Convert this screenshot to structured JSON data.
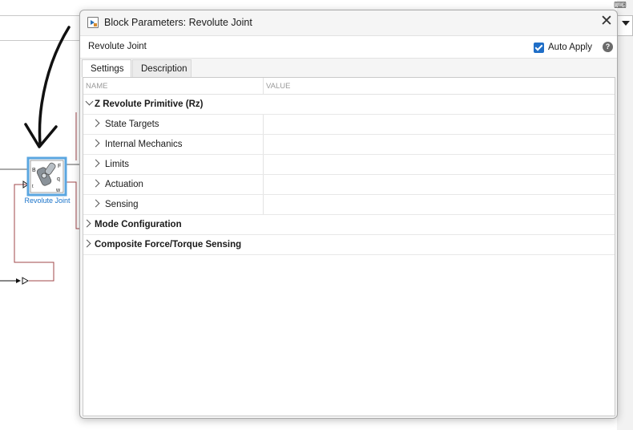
{
  "canvas": {
    "block": {
      "label": "Revolute Joint",
      "port_left_top": "B",
      "port_right_top": "F",
      "port_right_mid": "q",
      "port_left_bottom": "t",
      "port_right_bottom": "w"
    }
  },
  "dialog": {
    "title": "Block Parameters: Revolute Joint",
    "close_glyph": "✕",
    "block_name": "Revolute Joint",
    "auto_apply": {
      "label": "Auto Apply",
      "checked": true
    },
    "help_glyph": "?",
    "tabs": [
      {
        "label": "Settings",
        "active": true
      },
      {
        "label": "Description",
        "active": false
      }
    ],
    "columns": {
      "name": "NAME",
      "value": "VALUE"
    },
    "groups": [
      {
        "label": "Z Revolute Primitive (Rz)",
        "expanded": true,
        "children": [
          {
            "label": "State Targets"
          },
          {
            "label": "Internal Mechanics"
          },
          {
            "label": "Limits"
          },
          {
            "label": "Actuation"
          },
          {
            "label": "Sensing"
          }
        ]
      },
      {
        "label": "Mode Configuration",
        "expanded": false
      },
      {
        "label": "Composite Force/Torque Sensing",
        "expanded": false
      }
    ]
  },
  "colors": {
    "accent": "#1f6ec7",
    "block_label": "#1a73c9",
    "signal_line": "#a0474a",
    "block_highlight": "#5aa6e0"
  }
}
